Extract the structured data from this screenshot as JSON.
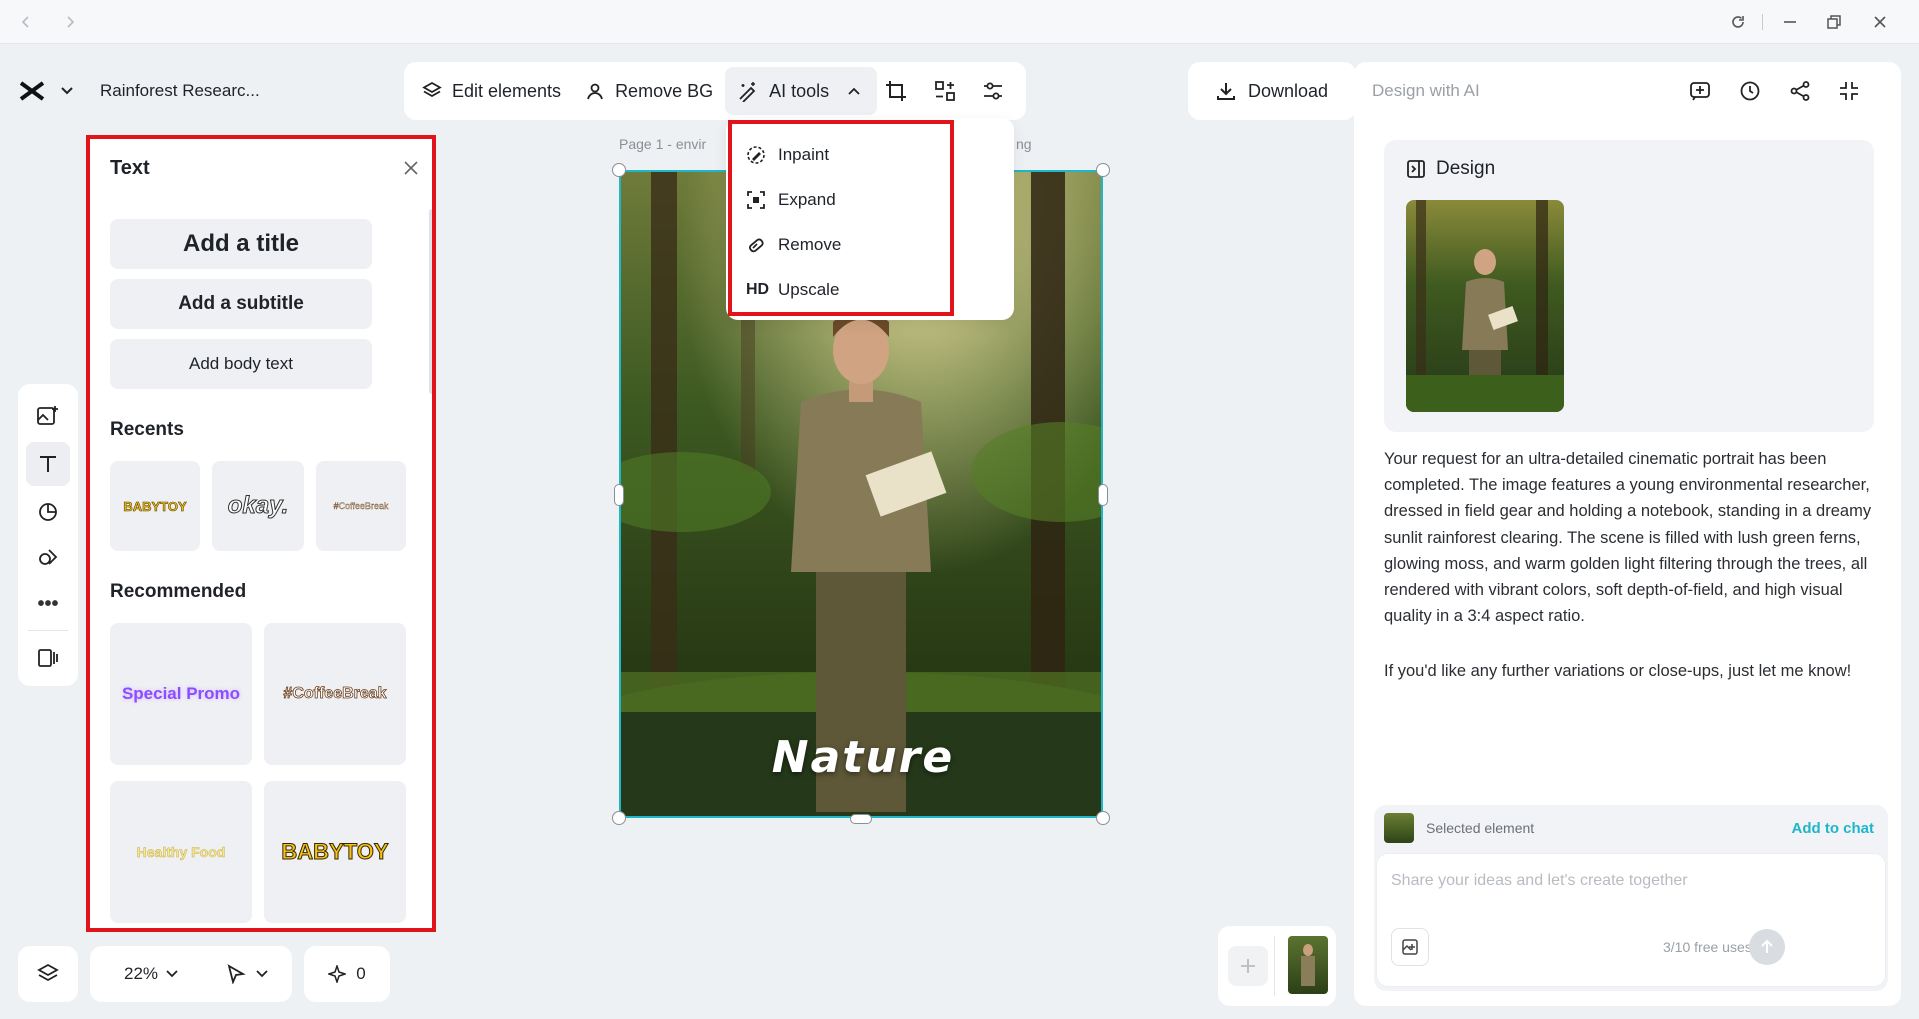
{
  "project": {
    "name": "Rainforest Researc..."
  },
  "toolbar": {
    "edit_elements": "Edit elements",
    "remove_bg": "Remove BG",
    "ai_tools": "AI tools"
  },
  "download": {
    "label": "Download"
  },
  "ai_dropdown": {
    "items": [
      {
        "label": "Inpaint",
        "icon": "inpaint-icon"
      },
      {
        "label": "Expand",
        "icon": "expand-icon"
      },
      {
        "label": "Remove",
        "icon": "eraser-icon"
      },
      {
        "label": "Upscale",
        "icon": "hd-icon",
        "badge": "HD"
      }
    ]
  },
  "canvas": {
    "page_label_left": "Page 1 -  envir",
    "page_label_right": "ng",
    "overlay_text": "Nature"
  },
  "text_panel": {
    "title": "Text",
    "add_title": "Add a title",
    "add_subtitle": "Add a subtitle",
    "add_body": "Add body text",
    "recents_heading": "Recents",
    "recents": [
      "BABYTOY",
      "okay.",
      "#CoffeeBreak"
    ],
    "recommended_heading": "Recommended",
    "recommended": [
      "Special Promo",
      "#CoffeeBreak",
      "Healthy Food",
      "BABYTOY"
    ]
  },
  "bottom_bar": {
    "zoom": "22%",
    "points": "0"
  },
  "right_panel": {
    "title": "Design with AI",
    "design_card_title": "Design",
    "message_p1": "Your request for an ultra-detailed cinematic portrait has been completed. The image features a young environmental researcher, dressed in field gear and holding a notebook, standing in a dreamy sunlit rainforest clearing. The scene is filled with lush green ferns, glowing moss, and warm golden light filtering through the trees, all rendered with vibrant colors, soft depth-of-field, and high visual quality in a 3:4 aspect ratio.",
    "message_p2": "If you'd like any further variations or close-ups, just let me know!",
    "selected_element": "Selected element",
    "add_to_chat": "Add to chat",
    "input_placeholder": "Share your ideas and let's create together",
    "free_uses": "3/10 free uses"
  },
  "colors": {
    "accent": "#1fb6c9",
    "highlight": "#e0151b",
    "panel_bg": "#eef1f4"
  }
}
